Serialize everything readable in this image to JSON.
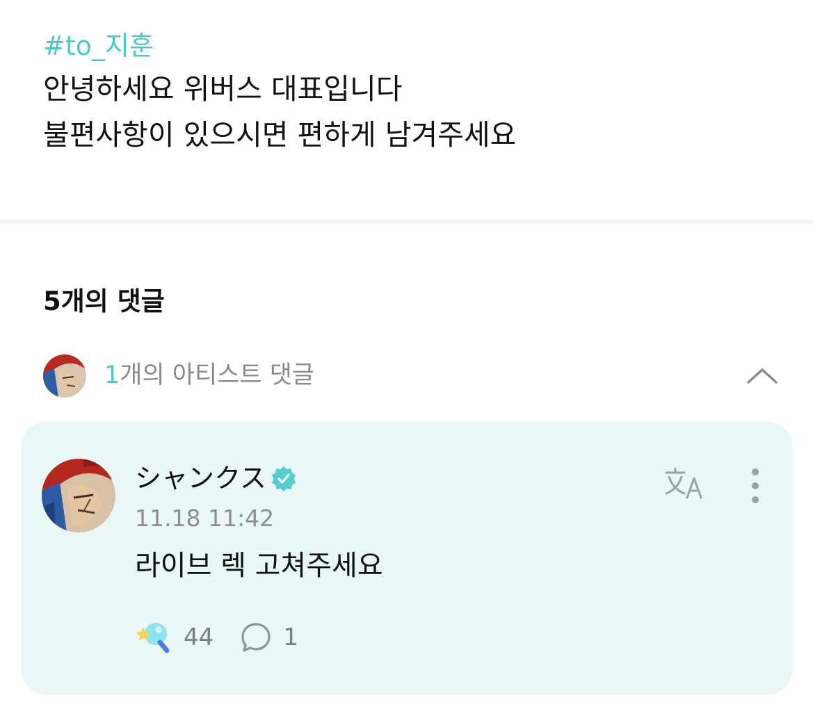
{
  "post": {
    "hashtag": "#to_지훈",
    "lines": [
      "안녕하세요 위버스 대표입니다",
      "불편사항이 있으시면 편하게 남겨주세요"
    ]
  },
  "comments_header": "5개의 댓글",
  "artist_comments": {
    "count": "1",
    "label": "개의 아티스트 댓글",
    "collapse_icon": "chevron-up-icon"
  },
  "comment": {
    "author": "シャンクス",
    "verified_icon": "verified-badge-icon",
    "timestamp": "11.18 11:42",
    "text": "라이브 렉 고쳐주세요",
    "likes": "44",
    "replies": "1",
    "translate_icon": "translate-icon",
    "more_icon": "more-vertical-icon"
  },
  "colors": {
    "accent": "#4fc7c7",
    "card_background": "#e9f8f7",
    "muted_text": "#8a8a8a"
  }
}
